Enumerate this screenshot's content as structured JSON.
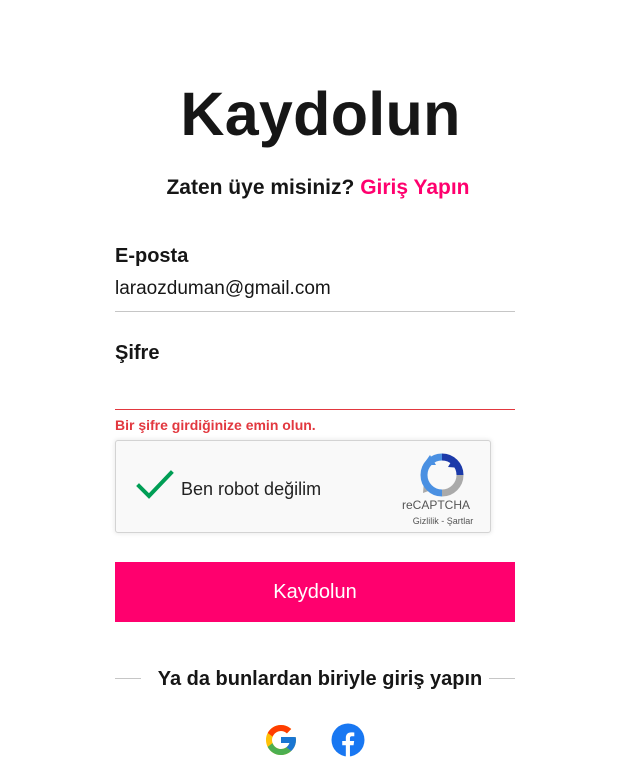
{
  "header": {
    "title": "Kaydolun",
    "subtitle_prefix": "Zaten üye misiniz?",
    "login_link": "Giriş Yapın"
  },
  "form": {
    "email": {
      "label": "E-posta",
      "value": "laraozduman@gmail.com"
    },
    "password": {
      "label": "Şifre",
      "value": "",
      "error": "Bir şifre girdiğinize emin olun."
    },
    "recaptcha": {
      "checked": true,
      "label": "Ben robot değilim",
      "brand": "reCAPTCHA",
      "privacy": "Gizlilik",
      "separator": " - ",
      "terms": "Şartlar"
    },
    "submit_label": "Kaydolun"
  },
  "social": {
    "divider_text": "Ya da bunlardan biriyle giriş yapın",
    "providers": [
      "google-icon",
      "facebook-icon"
    ]
  },
  "colors": {
    "accent": "#ff006e",
    "error": "#e2383f",
    "text": "#161616",
    "check": "#009e55",
    "facebook": "#1877f2"
  }
}
